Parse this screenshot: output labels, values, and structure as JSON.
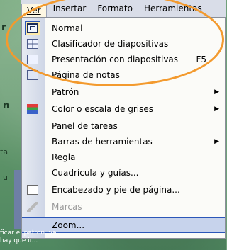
{
  "background": {
    "left_letters": [
      "r",
      "n",
      "ta",
      "u"
    ],
    "bottom_text": [
      "ficar el patron, ya",
      "hay que ir..."
    ]
  },
  "menubar": {
    "items": [
      "Ver",
      "Insertar",
      "Formato",
      "Herramientas"
    ]
  },
  "menu": {
    "items": [
      {
        "label": "Normal",
        "icon": "normal-view-icon",
        "checked": true
      },
      {
        "label": "Clasificador de diapositivas",
        "icon": "slide-sorter-icon"
      },
      {
        "label": "Presentación con diapositivas",
        "icon": "slide-show-icon",
        "shortcut": "F5"
      },
      {
        "label": "Página de notas",
        "icon": "notes-page-icon"
      },
      {
        "label": "Patrón",
        "submenu": true
      },
      {
        "label": "Color o escala de grises",
        "icon": "color-grayscale-icon",
        "submenu": true
      },
      {
        "label": "Panel de tareas"
      },
      {
        "label": "Barras de herramientas",
        "submenu": true
      },
      {
        "label": "Regla"
      },
      {
        "label": "Cuadrícula y guías..."
      },
      {
        "label": "Encabezado y pie de página...",
        "icon": "header-footer-icon"
      },
      {
        "label": "Marcas",
        "icon": "markup-icon",
        "disabled": true
      },
      {
        "label": "Zoom...",
        "highlighted": true
      }
    ]
  },
  "colors": {
    "highlight_ellipse": "#f39a2e",
    "selection": "#c7d3ec",
    "menu_bg": "#fbfbf8"
  }
}
